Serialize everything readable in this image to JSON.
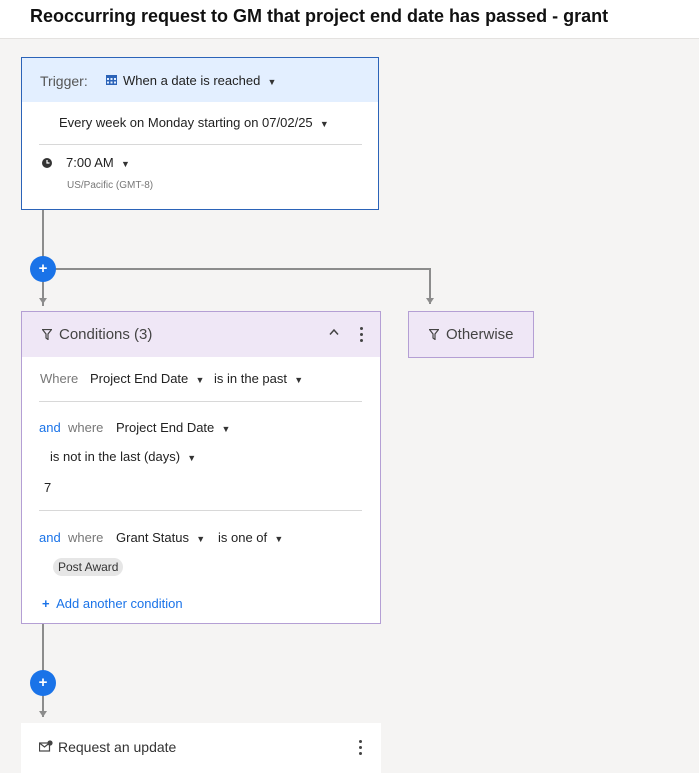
{
  "page": {
    "title": "Reoccurring request to GM that project end date has passed - grant"
  },
  "trigger": {
    "label": "Trigger:",
    "type": "When a date is reached",
    "schedule": "Every week on Monday starting on 07/02/25",
    "time": "7:00 AM",
    "timezone": "US/Pacific (GMT-8)"
  },
  "add_step": {
    "symbol": "+"
  },
  "conditions": {
    "title": "Conditions (3)",
    "rows": [
      {
        "connector": "",
        "where": "Where",
        "field": "Project End Date",
        "operator": "is in the past"
      },
      {
        "connector": "and",
        "where": "where",
        "field": "Project End Date",
        "operator": "is not in the last (days)",
        "value": "7"
      },
      {
        "connector": "and",
        "where": "where",
        "field": "Grant Status",
        "operator": "is one of",
        "chip": "Post Award"
      }
    ],
    "add_label": "Add another condition"
  },
  "otherwise": {
    "title": "Otherwise"
  },
  "action": {
    "title": "Request an update"
  },
  "colors": {
    "accent": "#1a73e8",
    "trigger_border": "#2b63b8",
    "condition_border": "#b49fd4",
    "condition_header": "#efe7f6"
  }
}
